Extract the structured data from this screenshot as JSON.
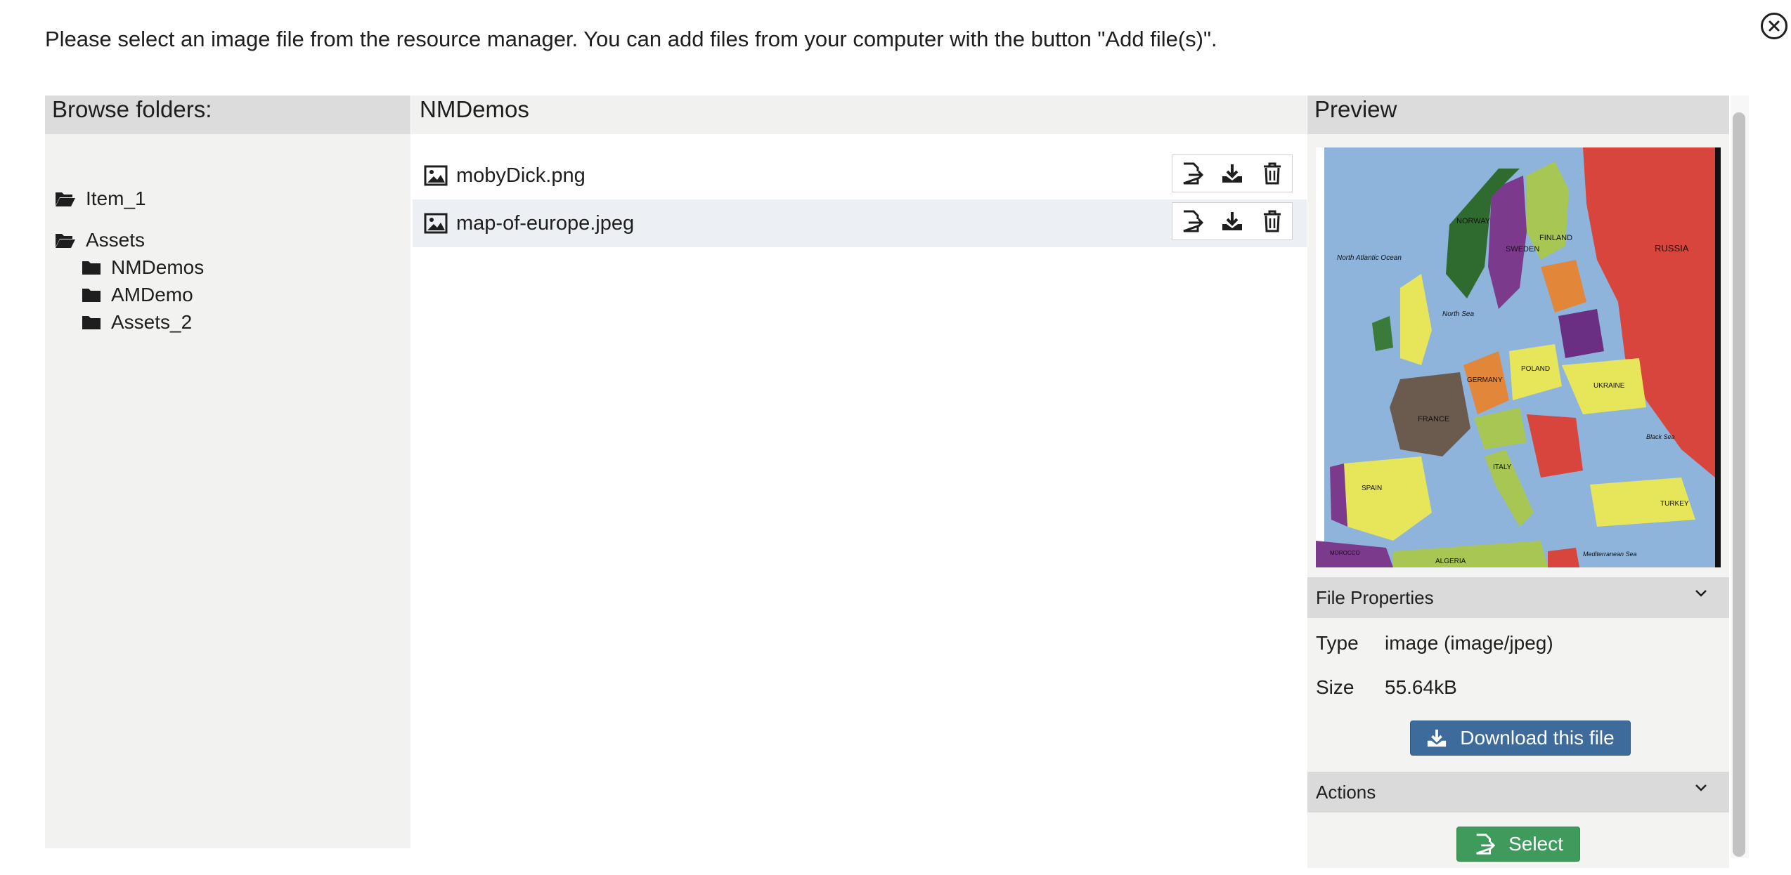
{
  "instructions": "Please select an image file from the resource manager. You can add files from your computer with the button \"Add file(s)\".",
  "folders": {
    "header": "Browse folders:",
    "items": [
      {
        "label": "Item_1"
      },
      {
        "label": "Assets"
      },
      {
        "label": "NMDemos"
      },
      {
        "label": "AMDemo"
      },
      {
        "label": "Assets_2"
      }
    ]
  },
  "files": {
    "header": "NMDemos",
    "items": [
      {
        "name": "mobyDick.png"
      },
      {
        "name": "map-of-europe.jpeg"
      }
    ]
  },
  "preview": {
    "header": "Preview",
    "map_labels": [
      "NORWAY",
      "SWEDEN",
      "FINLAND",
      "RUSSIA",
      "North Atlantic Ocean",
      "North Sea",
      "GERMANY",
      "POLAND",
      "UKRAINE",
      "FRANCE",
      "ITALY",
      "SPAIN",
      "TURKEY",
      "ALGERIA",
      "MOROCCO",
      "Black Sea",
      "Mediterranean Sea"
    ],
    "file_properties": {
      "header": "File Properties",
      "type_label": "Type",
      "type_value": "image (image/jpeg)",
      "size_label": "Size",
      "size_value": "55.64kB",
      "download_label": "Download this file"
    },
    "actions": {
      "header": "Actions",
      "select_label": "Select"
    }
  },
  "colors": {
    "download_button": "#3c6b9c",
    "select_button": "#3f9b5b",
    "selected_row": "#ecf0f5"
  }
}
